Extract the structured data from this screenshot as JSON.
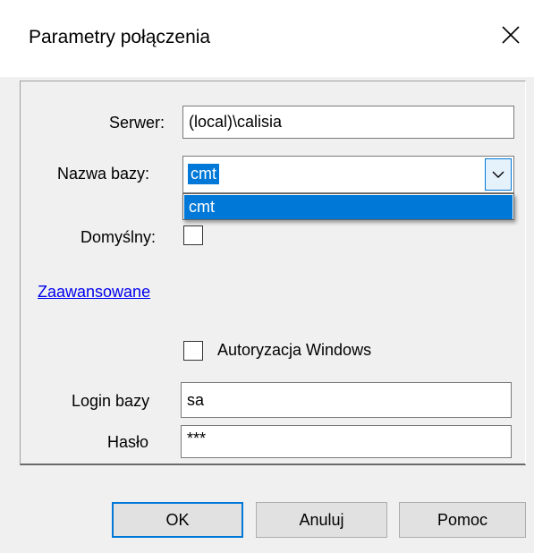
{
  "window": {
    "title": "Parametry połączenia",
    "close_icon": "close-icon"
  },
  "form": {
    "server_label": "Serwer:",
    "server_value": "(local)\\calisia",
    "database_label": "Nazwa bazy:",
    "database_value": "cmt",
    "database_options": [
      "cmt"
    ],
    "default_label": "Domyślny:",
    "default_checked": false,
    "advanced_link": "Zaawansowane",
    "windows_auth_label": "Autoryzacja Windows",
    "windows_auth_checked": false,
    "login_label": "Login bazy",
    "login_value": "sa",
    "password_label": "Hasło",
    "password_value": "***"
  },
  "buttons": {
    "ok_label": "OK",
    "cancel_label": "Anuluj",
    "help_label": "Pomoc"
  },
  "colors": {
    "selection": "#0078d7",
    "dialog_bg": "#f0f0f0",
    "link": "#0000ee"
  }
}
